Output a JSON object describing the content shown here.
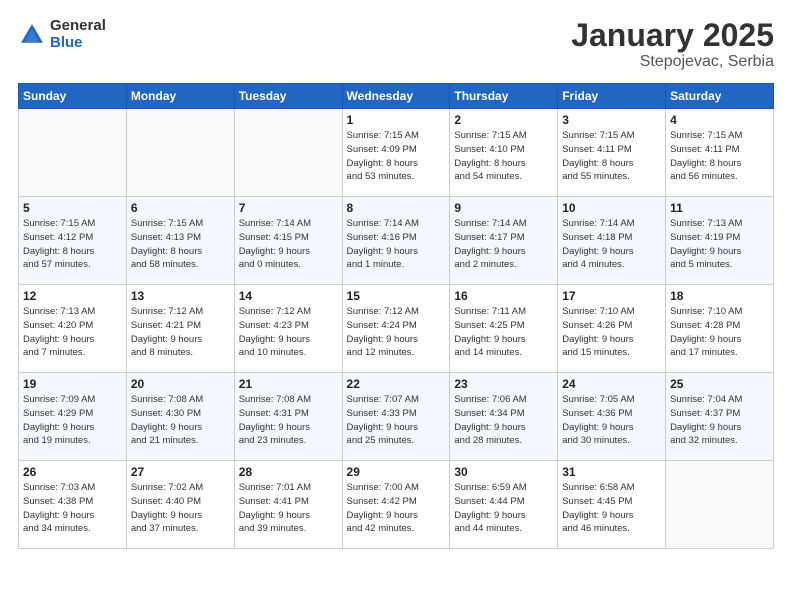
{
  "logo": {
    "general": "General",
    "blue": "Blue"
  },
  "title": "January 2025",
  "location": "Stepojevac, Serbia",
  "weekdays": [
    "Sunday",
    "Monday",
    "Tuesday",
    "Wednesday",
    "Thursday",
    "Friday",
    "Saturday"
  ],
  "weeks": [
    [
      {
        "day": "",
        "info": ""
      },
      {
        "day": "",
        "info": ""
      },
      {
        "day": "",
        "info": ""
      },
      {
        "day": "1",
        "info": "Sunrise: 7:15 AM\nSunset: 4:09 PM\nDaylight: 8 hours\nand 53 minutes."
      },
      {
        "day": "2",
        "info": "Sunrise: 7:15 AM\nSunset: 4:10 PM\nDaylight: 8 hours\nand 54 minutes."
      },
      {
        "day": "3",
        "info": "Sunrise: 7:15 AM\nSunset: 4:11 PM\nDaylight: 8 hours\nand 55 minutes."
      },
      {
        "day": "4",
        "info": "Sunrise: 7:15 AM\nSunset: 4:11 PM\nDaylight: 8 hours\nand 56 minutes."
      }
    ],
    [
      {
        "day": "5",
        "info": "Sunrise: 7:15 AM\nSunset: 4:12 PM\nDaylight: 8 hours\nand 57 minutes."
      },
      {
        "day": "6",
        "info": "Sunrise: 7:15 AM\nSunset: 4:13 PM\nDaylight: 8 hours\nand 58 minutes."
      },
      {
        "day": "7",
        "info": "Sunrise: 7:14 AM\nSunset: 4:15 PM\nDaylight: 9 hours\nand 0 minutes."
      },
      {
        "day": "8",
        "info": "Sunrise: 7:14 AM\nSunset: 4:16 PM\nDaylight: 9 hours\nand 1 minute."
      },
      {
        "day": "9",
        "info": "Sunrise: 7:14 AM\nSunset: 4:17 PM\nDaylight: 9 hours\nand 2 minutes."
      },
      {
        "day": "10",
        "info": "Sunrise: 7:14 AM\nSunset: 4:18 PM\nDaylight: 9 hours\nand 4 minutes."
      },
      {
        "day": "11",
        "info": "Sunrise: 7:13 AM\nSunset: 4:19 PM\nDaylight: 9 hours\nand 5 minutes."
      }
    ],
    [
      {
        "day": "12",
        "info": "Sunrise: 7:13 AM\nSunset: 4:20 PM\nDaylight: 9 hours\nand 7 minutes."
      },
      {
        "day": "13",
        "info": "Sunrise: 7:12 AM\nSunset: 4:21 PM\nDaylight: 9 hours\nand 8 minutes."
      },
      {
        "day": "14",
        "info": "Sunrise: 7:12 AM\nSunset: 4:23 PM\nDaylight: 9 hours\nand 10 minutes."
      },
      {
        "day": "15",
        "info": "Sunrise: 7:12 AM\nSunset: 4:24 PM\nDaylight: 9 hours\nand 12 minutes."
      },
      {
        "day": "16",
        "info": "Sunrise: 7:11 AM\nSunset: 4:25 PM\nDaylight: 9 hours\nand 14 minutes."
      },
      {
        "day": "17",
        "info": "Sunrise: 7:10 AM\nSunset: 4:26 PM\nDaylight: 9 hours\nand 15 minutes."
      },
      {
        "day": "18",
        "info": "Sunrise: 7:10 AM\nSunset: 4:28 PM\nDaylight: 9 hours\nand 17 minutes."
      }
    ],
    [
      {
        "day": "19",
        "info": "Sunrise: 7:09 AM\nSunset: 4:29 PM\nDaylight: 9 hours\nand 19 minutes."
      },
      {
        "day": "20",
        "info": "Sunrise: 7:08 AM\nSunset: 4:30 PM\nDaylight: 9 hours\nand 21 minutes."
      },
      {
        "day": "21",
        "info": "Sunrise: 7:08 AM\nSunset: 4:31 PM\nDaylight: 9 hours\nand 23 minutes."
      },
      {
        "day": "22",
        "info": "Sunrise: 7:07 AM\nSunset: 4:33 PM\nDaylight: 9 hours\nand 25 minutes."
      },
      {
        "day": "23",
        "info": "Sunrise: 7:06 AM\nSunset: 4:34 PM\nDaylight: 9 hours\nand 28 minutes."
      },
      {
        "day": "24",
        "info": "Sunrise: 7:05 AM\nSunset: 4:36 PM\nDaylight: 9 hours\nand 30 minutes."
      },
      {
        "day": "25",
        "info": "Sunrise: 7:04 AM\nSunset: 4:37 PM\nDaylight: 9 hours\nand 32 minutes."
      }
    ],
    [
      {
        "day": "26",
        "info": "Sunrise: 7:03 AM\nSunset: 4:38 PM\nDaylight: 9 hours\nand 34 minutes."
      },
      {
        "day": "27",
        "info": "Sunrise: 7:02 AM\nSunset: 4:40 PM\nDaylight: 9 hours\nand 37 minutes."
      },
      {
        "day": "28",
        "info": "Sunrise: 7:01 AM\nSunset: 4:41 PM\nDaylight: 9 hours\nand 39 minutes."
      },
      {
        "day": "29",
        "info": "Sunrise: 7:00 AM\nSunset: 4:42 PM\nDaylight: 9 hours\nand 42 minutes."
      },
      {
        "day": "30",
        "info": "Sunrise: 6:59 AM\nSunset: 4:44 PM\nDaylight: 9 hours\nand 44 minutes."
      },
      {
        "day": "31",
        "info": "Sunrise: 6:58 AM\nSunset: 4:45 PM\nDaylight: 9 hours\nand 46 minutes."
      },
      {
        "day": "",
        "info": ""
      }
    ]
  ]
}
